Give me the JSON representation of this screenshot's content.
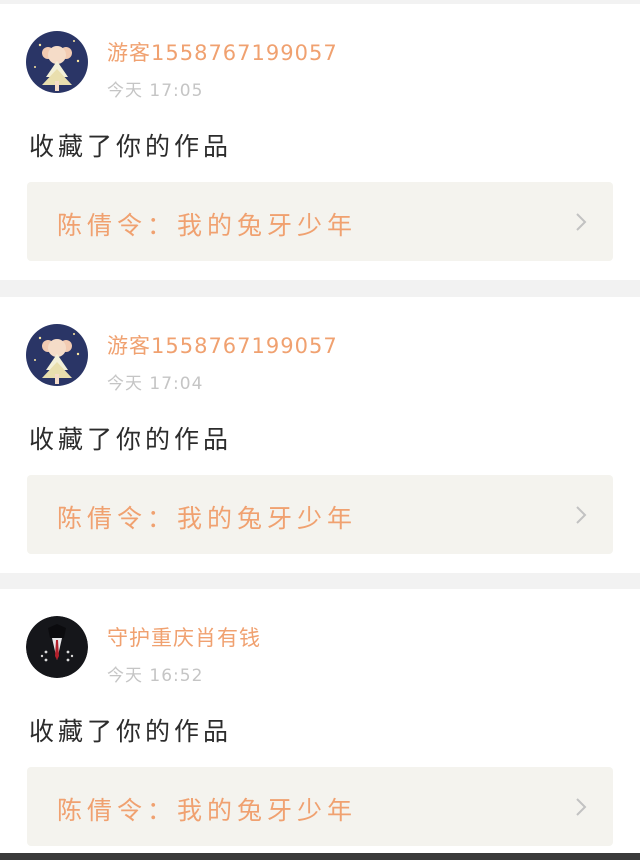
{
  "notifications": [
    {
      "username": "游客1558767199057",
      "time": "今天 17:05",
      "action": "收藏了你的作品",
      "work_title": "陈倩令：我的兔牙少年",
      "avatar_icon": "anime-girl-avatar"
    },
    {
      "username": "游客1558767199057",
      "time": "今天 17:04",
      "action": "收藏了你的作品",
      "work_title": "陈倩令：我的兔牙少年",
      "avatar_icon": "anime-girl-avatar"
    },
    {
      "username": "守护重庆肖有钱",
      "time": "今天 16:52",
      "action": "收藏了你的作品",
      "work_title": "陈倩令：我的兔牙少年",
      "avatar_icon": "suited-man-avatar"
    }
  ],
  "colors": {
    "accent": "#f0a170",
    "time": "#c5c5c5",
    "text": "#2c2c2c",
    "box": "#f4f3ee",
    "divider": "#f2f2f2"
  }
}
